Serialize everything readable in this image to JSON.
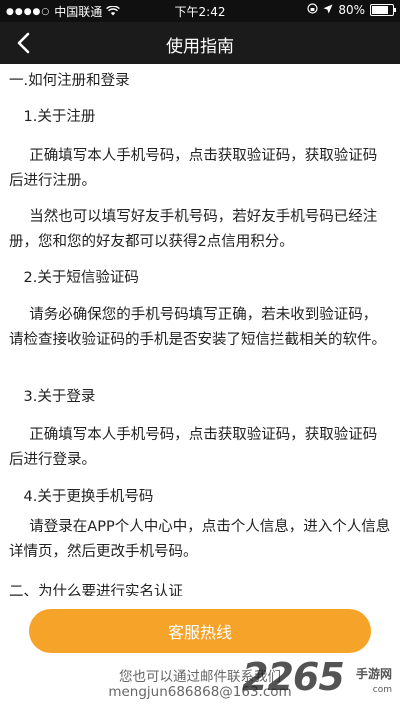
{
  "status_bar": {
    "carrier": "中国联通",
    "time": "下午2:42",
    "battery": "80%",
    "battery_level": 0.8
  },
  "nav": {
    "title": "使用指南"
  },
  "content": {
    "section1_heading": "一.如何注册和登录",
    "sub1_title": "1.关于注册",
    "sub1_p1": "正确填写本人手机号码，点击获取验证码，获取验证码后进行注册。",
    "sub1_p2": "当然也可以填写好友手机号码，若好友手机号码已经注册，您和您的好友都可以获得2点信用积分。",
    "sub2_title": "2.关于短信验证码",
    "sub2_p1": "请务必确保您的手机号码填写正确，若未收到验证码，请检查接收验证码的手机是否安装了短信拦截相关的软件。",
    "sub3_title": "3.关于登录",
    "sub3_p1": "正确填写本人手机号码，点击获取验证码，获取验证码后进行登录。",
    "sub4_title": "4.关于更换手机号码",
    "sub4_p1": "请登录在APP个人中心中，点击个人信息，进入个人信息详情页，然后更改手机号码。",
    "section2_heading": "二、为什么要进行实名认证"
  },
  "bottom": {
    "hotline_label": "客服热线",
    "contact_note": "您也可以通过邮件联系我们",
    "contact_email": "mengjun686868@163.com"
  },
  "watermark": {
    "number": "2265",
    "text": "手游网",
    "url": "com"
  },
  "colors": {
    "accent": "#f6a32a",
    "navbar": "#1b1b1b"
  }
}
